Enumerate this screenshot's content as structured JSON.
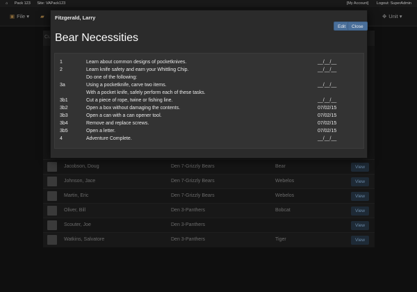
{
  "sysbar": {
    "pack": "Pack 123",
    "site": "Site: VAPack123",
    "account": "[My Account]",
    "logout": "Logout: SuperAdmin"
  },
  "navbar": {
    "file": "File ▾",
    "unit": "Unit ▾"
  },
  "background": {
    "header": "Cu",
    "rows": [
      {
        "name": "Jacobson, Doug",
        "den": "Den 7-Grizzly Bears",
        "rank": "Bear",
        "view": "View"
      },
      {
        "name": "Johnson, Jace",
        "den": "Den 7-Grizzly Bears",
        "rank": "Webelos",
        "view": "View"
      },
      {
        "name": "Martin, Eric",
        "den": "Den 7-Grizzly Bears",
        "rank": "Webelos",
        "view": "View"
      },
      {
        "name": "Oliver, Bill",
        "den": "Den 3-Panthers",
        "rank": "Bobcat",
        "view": "View"
      },
      {
        "name": "Scouter, Joe",
        "den": "Den 3-Panthers",
        "rank": "",
        "view": "View"
      },
      {
        "name": "Watkins, Salvatore",
        "den": "Den 3-Panthers",
        "rank": "Tiger",
        "view": "View"
      }
    ]
  },
  "modal": {
    "scout_name": "Fitzgerald, Larry",
    "edit_label": "Edit",
    "close_label": "Close",
    "title": "Bear Necessities",
    "requirements": [
      {
        "num": "1",
        "text": "Learn about common designs of pocketknives.",
        "date": "__/__/__"
      },
      {
        "num": "2",
        "text": "Learn knife safety and earn your Whittling Chip.",
        "date": "__/__/__"
      },
      {
        "num": "",
        "text": "Do one of the following:",
        "date": ""
      },
      {
        "num": "3a",
        "text": "Using a pocketknife, carve two items.",
        "date": "__/__/__"
      },
      {
        "num": "",
        "text": "With a pocket knife, safely perform each of these tasks.",
        "date": ""
      },
      {
        "num": "3b1",
        "text": "Cut a piece of rope, twine or fishing line.",
        "date": "__/__/__"
      },
      {
        "num": "3b2",
        "text": "Open a box without damaging the contents.",
        "date": "07/02/15"
      },
      {
        "num": "3b3",
        "text": "Open a can with a can opener tool.",
        "date": "07/02/15"
      },
      {
        "num": "3b4",
        "text": "Remove and replace screws.",
        "date": "07/02/15"
      },
      {
        "num": "3b5",
        "text": "Open a letter.",
        "date": "07/02/15"
      },
      {
        "num": "4",
        "text": "Adventure Complete.",
        "date": "__/__/__"
      }
    ]
  }
}
